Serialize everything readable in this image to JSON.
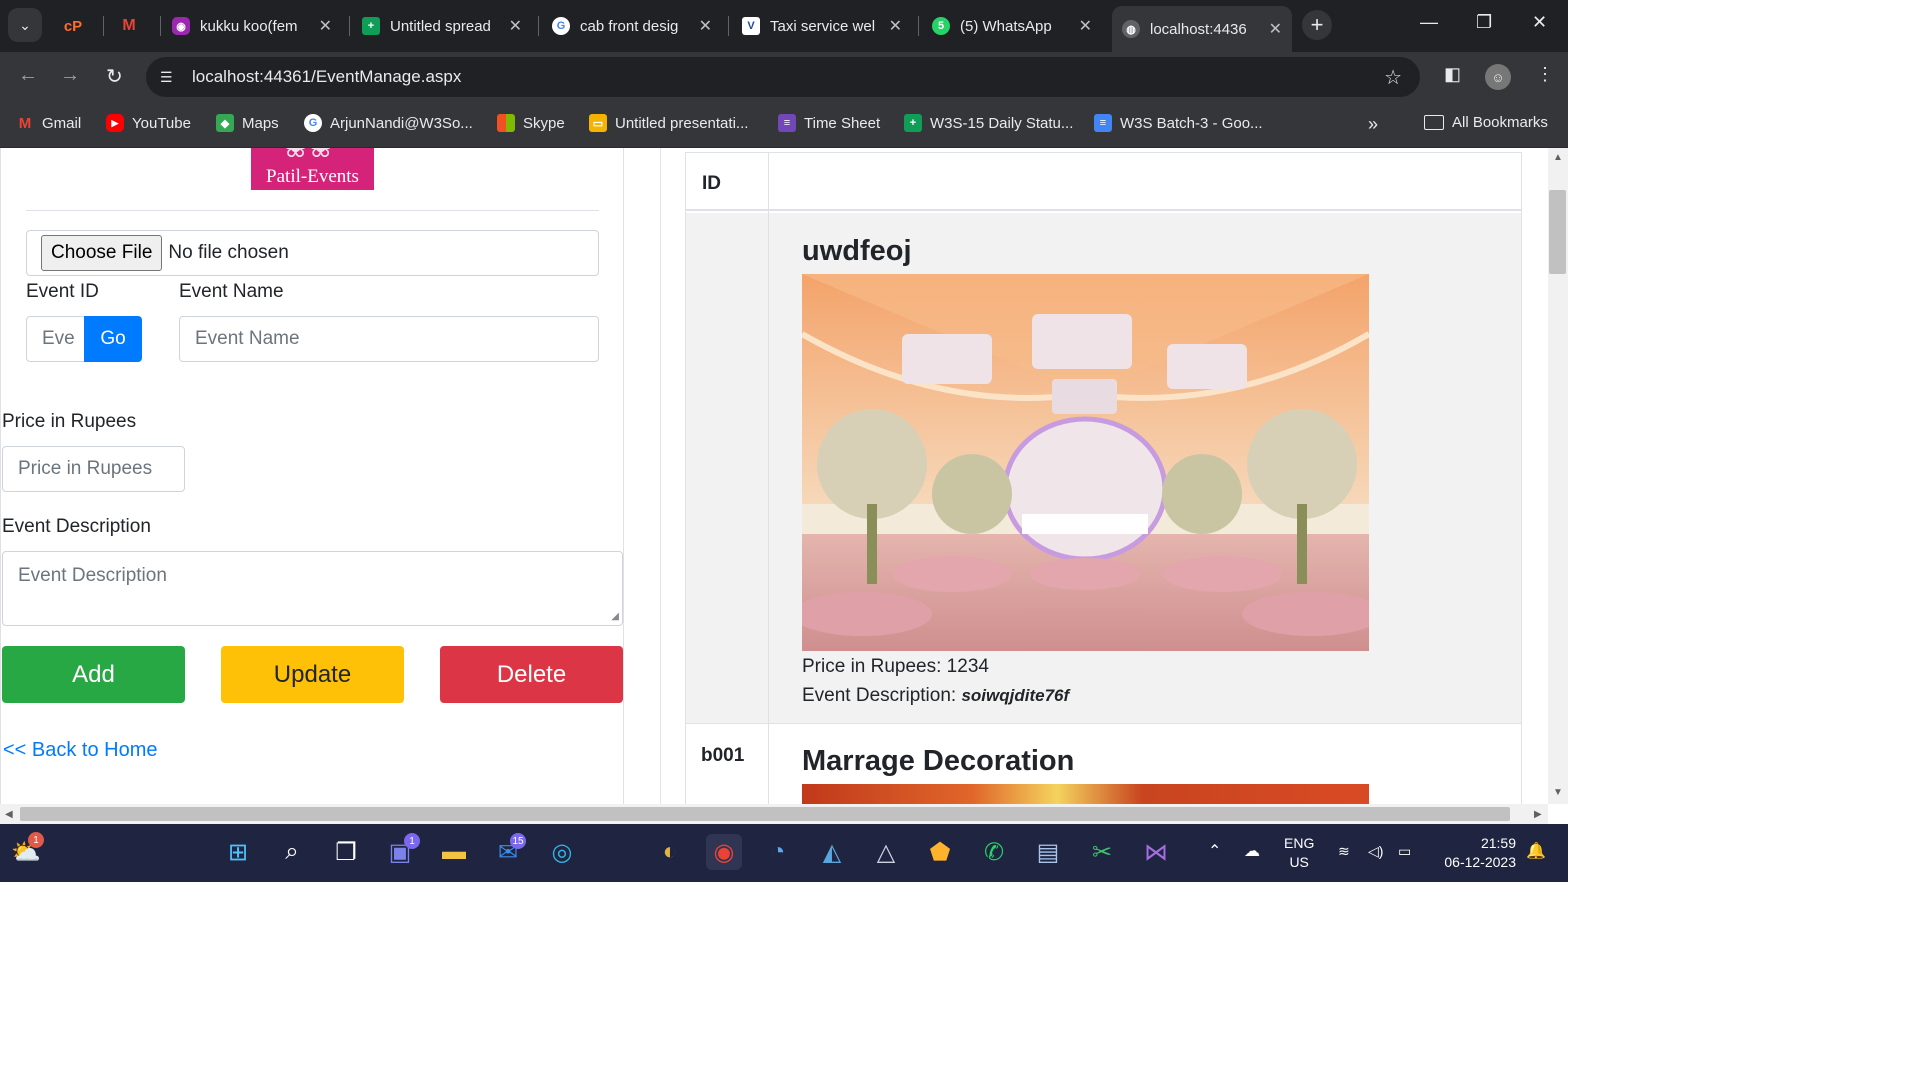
{
  "browser": {
    "tabs": [
      {
        "title": "",
        "favicon": "cpanel-icon",
        "color": "#ff6c2c"
      },
      {
        "title": "",
        "favicon": "gmail-icon",
        "color": "#ea4335"
      },
      {
        "title": "kukku koo(fem",
        "favicon": "podcast-icon",
        "color": "#9c27b0"
      },
      {
        "title": "Untitled spread",
        "favicon": "sheets-icon",
        "color": "#0f9d58"
      },
      {
        "title": "cab front desig",
        "favicon": "google-icon",
        "color": "#4285f4"
      },
      {
        "title": "Taxi service wel",
        "favicon": "v-icon",
        "color": "#1e88e5"
      },
      {
        "title": "(5) WhatsApp",
        "favicon": "whatsapp-icon",
        "color": "#25d366"
      },
      {
        "title": "localhost:4436",
        "favicon": "globe-icon",
        "color": "#9aa0a6"
      }
    ],
    "url": "localhost:44361/EventManage.aspx",
    "bookmarks": [
      {
        "label": "Gmail",
        "icon": "gmail-icon",
        "color": "#ea4335"
      },
      {
        "label": "YouTube",
        "icon": "youtube-icon",
        "color": "#ff0000"
      },
      {
        "label": "Maps",
        "icon": "maps-icon",
        "color": "#34a853"
      },
      {
        "label": "ArjunNandi@W3So...",
        "icon": "google-icon",
        "color": "#4285f4"
      },
      {
        "label": "Skype",
        "icon": "microsoft-icon",
        "color": "#f25022"
      },
      {
        "label": "Untitled presentati...",
        "icon": "slides-icon",
        "color": "#f4b400"
      },
      {
        "label": "Time Sheet",
        "icon": "forms-icon",
        "color": "#7248b9"
      },
      {
        "label": "W3S-15 Daily Statu...",
        "icon": "sheets-icon",
        "color": "#0f9d58"
      },
      {
        "label": "W3S Batch-3 - Goo...",
        "icon": "docs-icon",
        "color": "#4285f4"
      }
    ],
    "all_bookmarks": "All Bookmarks"
  },
  "form": {
    "logo_text": "Patil-Events",
    "choose_file": "Choose File",
    "no_file": "No file chosen",
    "event_id_label": "Event ID",
    "event_id_placeholder": "Eve",
    "go_label": "Go",
    "event_name_label": "Event Name",
    "event_name_placeholder": "Event Name",
    "price_label": "Price in Rupees",
    "price_placeholder": "Price in Rupees",
    "desc_label": "Event Description",
    "desc_placeholder": "Event Description",
    "add_label": "Add",
    "update_label": "Update",
    "delete_label": "Delete",
    "back_link": "<< Back to Home"
  },
  "grid": {
    "header_id": "ID",
    "rows": [
      {
        "id": "",
        "name": "uwdfeoj",
        "price_text": "Price in Rupees: 1234",
        "desc_prefix": "Event Description: ",
        "desc_value": "soiwqjdite76f"
      },
      {
        "id": "b001",
        "name": "Marrage Decoration"
      }
    ]
  },
  "taskbar": {
    "lang": "ENG",
    "region": "US",
    "time": "21:59",
    "date": "06-12-2023",
    "badges": {
      "weather": "1",
      "chat": "1",
      "mail": "15"
    }
  },
  "colors": {
    "primary": "#007bff",
    "success": "#28a745",
    "warning": "#ffc107",
    "danger": "#dc3545",
    "logo_pink": "#d6237a"
  }
}
